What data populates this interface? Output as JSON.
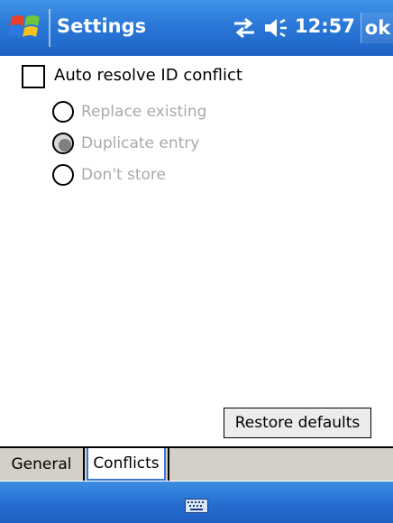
{
  "titlebar": {
    "title": "Settings",
    "clock": "12:57",
    "ok_label": "ok",
    "icons": [
      "windows-start-icon",
      "connectivity-icon",
      "speaker-icon"
    ]
  },
  "content": {
    "auto_resolve": {
      "label": "Auto resolve ID conflict",
      "checked": false
    },
    "options": [
      {
        "label": "Replace existing",
        "selected": false,
        "enabled": false
      },
      {
        "label": "Duplicate entry",
        "selected": true,
        "enabled": false
      },
      {
        "label": "Don't store",
        "selected": false,
        "enabled": false
      }
    ],
    "restore_label": "Restore defaults"
  },
  "tabs": [
    {
      "label": "General",
      "active": false
    },
    {
      "label": "Conflicts",
      "active": true
    }
  ],
  "menubar": {
    "icon": "keyboard-icon"
  },
  "colors": {
    "titlebar_blue": "#2a78d8",
    "disabled_text": "#a9a9a9",
    "tab_strip": "#d4d0c8",
    "active_tab_border": "#3a78d6"
  }
}
